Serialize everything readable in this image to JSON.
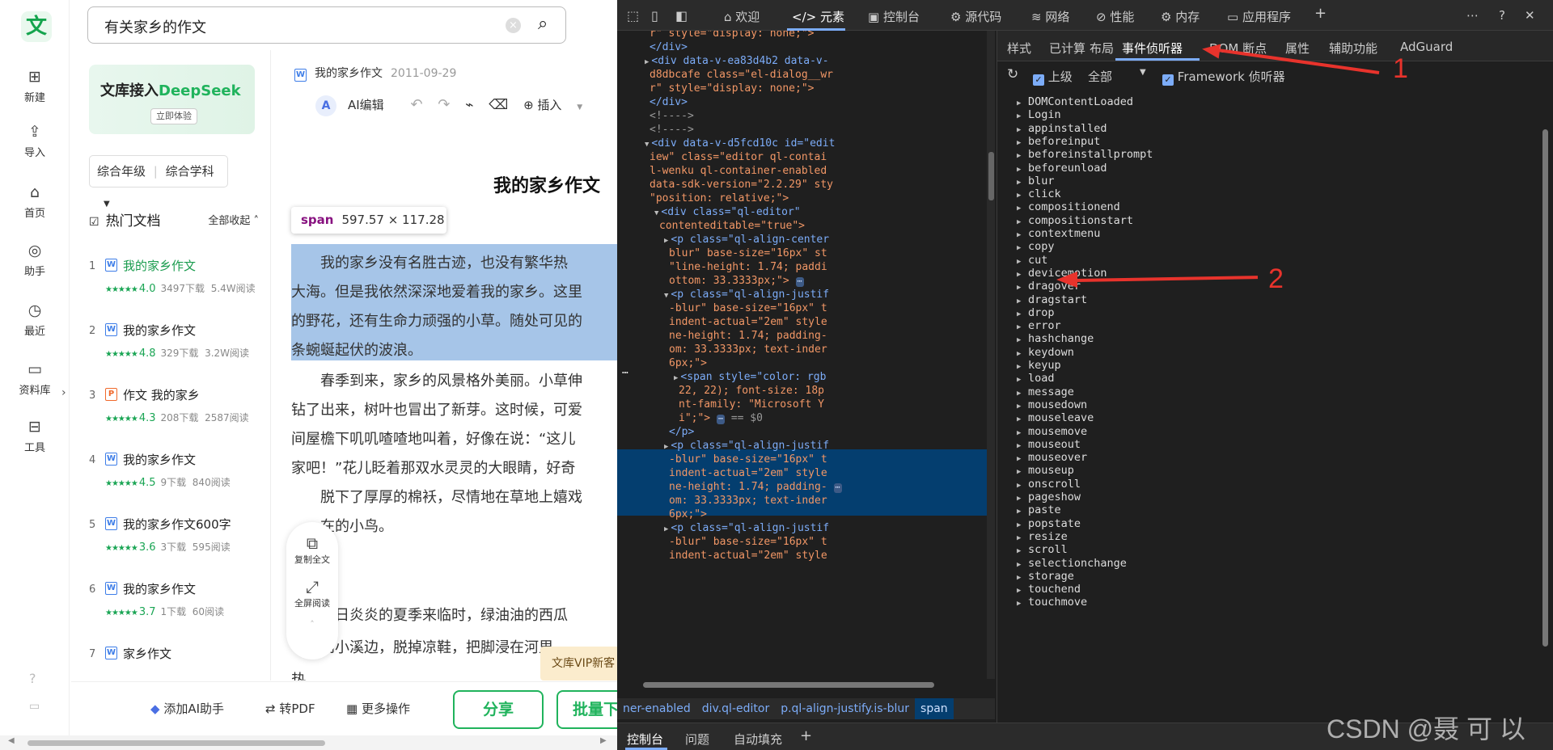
{
  "left": {
    "logo": "文",
    "search_value": "有关家乡的作文",
    "rail": [
      "新建",
      "导入",
      "首页",
      "助手",
      "最近",
      "资料库",
      "工具"
    ],
    "banner_title_a": "文库接入",
    "banner_title_b": "DeepSeek",
    "banner_btn": "立即体验",
    "grade": "综合年级",
    "subject": "综合学科",
    "hot_title": "热门文档",
    "collapse_all": "全部收起",
    "docs": [
      {
        "n": "1",
        "title": "我的家乡作文",
        "score": "4.0",
        "dl": "3497下载",
        "read": "5.4W阅读",
        "type": "W"
      },
      {
        "n": "2",
        "title": "我的家乡作文",
        "score": "4.8",
        "dl": "329下载",
        "read": "3.2W阅读",
        "type": "W"
      },
      {
        "n": "3",
        "title": "作文 我的家乡",
        "score": "4.3",
        "dl": "208下载",
        "read": "2587阅读",
        "type": "P"
      },
      {
        "n": "4",
        "title": "我的家乡作文",
        "score": "4.5",
        "dl": "9下载",
        "read": "840阅读",
        "type": "W"
      },
      {
        "n": "5",
        "title": "我的家乡作文600字",
        "score": "3.6",
        "dl": "3下载",
        "read": "595阅读",
        "type": "W"
      },
      {
        "n": "6",
        "title": "我的家乡作文",
        "score": "3.7",
        "dl": "1下载",
        "read": "60阅读",
        "type": "W"
      },
      {
        "n": "7",
        "title": "家乡作文",
        "score": "",
        "dl": "",
        "read": "",
        "type": "W"
      }
    ],
    "doc_header_title": "我的家乡作文",
    "doc_header_date": "2011-09-29",
    "toolbar_ai": "AI编辑",
    "toolbar_insert": "插入",
    "doc_title": "我的家乡作文",
    "tooltip_tag": "span",
    "tooltip_size": "597.57 × 117.28",
    "para1": [
      "　　我的家乡没有名胜古迹，也没有繁华热",
      "大海。但是我依然深深地爱着我的家乡。这里",
      "的野花，还有生命力顽强的小草。随处可见的",
      "条蜿蜒起伏的波浪。"
    ],
    "para2": [
      "　　春季到来，家乡的风景格外美丽。小草伸",
      "钻了出来，树叶也冒出了新芽。这时候，可爱",
      "间屋檐下叽叽喳喳地叫着，好像在说：“这儿",
      "家吧！”花儿眨着那双水灵灵的大眼睛，好奇",
      "　　脱下了厚厚的棉袄，尽情地在草地上嬉戏",
      "　　在的小鸟。"
    ],
    "para3": [
      "　　烈日炎炎的夏季来临时，绿油油的西瓜",
      "　　到小溪边，脱掉凉鞋，把脚浸在河里",
      "热。"
    ],
    "float_copy": "复制全文",
    "float_full": "全屏阅读",
    "vip": "文库VIP新客",
    "add_ai": "添加AI助手",
    "to_pdf": "转PDF",
    "more_ops": "更多操作",
    "share": "分享",
    "batch_dl": "批量下载("
  },
  "dev": {
    "tabs": [
      "欢迎",
      "元素",
      "控制台",
      "源代码",
      "网络",
      "性能",
      "内存",
      "应用程序"
    ],
    "subtabs": [
      "样式",
      "已计算",
      "布局",
      "事件侦听器",
      "DOM 断点",
      "属性",
      "辅助功能",
      "AdGuard"
    ],
    "opt_ancestors": "上级",
    "opt_all": "全部",
    "opt_framework": "Framework 侦听器",
    "events": [
      "DOMContentLoaded",
      "Login",
      "appinstalled",
      "beforeinput",
      "beforeinstallprompt",
      "beforeunload",
      "blur",
      "click",
      "compositionend",
      "compositionstart",
      "contextmenu",
      "copy",
      "cut",
      "devicemotion",
      "dragover",
      "dragstart",
      "drop",
      "error",
      "hashchange",
      "keydown",
      "keyup",
      "load",
      "message",
      "mousedown",
      "mouseleave",
      "mousemove",
      "mouseout",
      "mouseover",
      "mouseup",
      "onscroll",
      "pageshow",
      "paste",
      "popstate",
      "resize",
      "scroll",
      "selectionchange",
      "storage",
      "touchend",
      "touchmove"
    ],
    "crumbs": [
      "ner-enabled",
      "div.ql-editor",
      "p.ql-align-justify.is-blur",
      "span"
    ],
    "drawer": [
      "控制台",
      "问题",
      "自动填充"
    ],
    "dom_lines": [
      "r\" style=\"display: none;\">",
      "</div>",
      "<div data-v-ea83d4b2 data-v-",
      "d8dbcafe class=\"el-dialog__wr",
      "r\" style=\"display: none;\">",
      "</div>",
      "<!---->",
      "<!---->",
      "<div data-v-d5fcd10c id=\"edit",
      "iew\" class=\"editor ql-contai",
      "l-wenku ql-container-enabled",
      "data-sdk-version=\"2.2.29\" sty",
      "\"position: relative;\">",
      "<div class=\"ql-editor\"",
      "contenteditable=\"true\">",
      "<p class=\"ql-align-center",
      "blur\" base-size=\"16px\" st",
      "\"line-height: 1.74; paddi",
      "ottom: 33.3333px;\">",
      "<p class=\"ql-align-justif",
      "-blur\" base-size=\"16px\" t",
      "indent-actual=\"2em\" style",
      "ne-height: 1.74; padding-",
      "om: 33.3333px; text-inder",
      "6px;\">",
      "<span style=\"color: rgb",
      "22, 22); font-size: 18p",
      "nt-family: \"Microsoft Y",
      "i\";\">",
      "</p>",
      "<p class=\"ql-align-justif",
      "-blur\" base-size=\"16px\" t",
      "indent-actual=\"2em\" style",
      "ne-height: 1.74; padding-",
      "om: 33.3333px; text-inder",
      "6px;\">",
      "<p class=\"ql-align-justif",
      "-blur\" base-size=\"16px\" t",
      "indent-actual=\"2em\" style"
    ],
    "sel_marker": "== $0"
  },
  "annotations": {
    "n1": "1",
    "n2": "2"
  },
  "watermark": "CSDN @聂 可 以"
}
